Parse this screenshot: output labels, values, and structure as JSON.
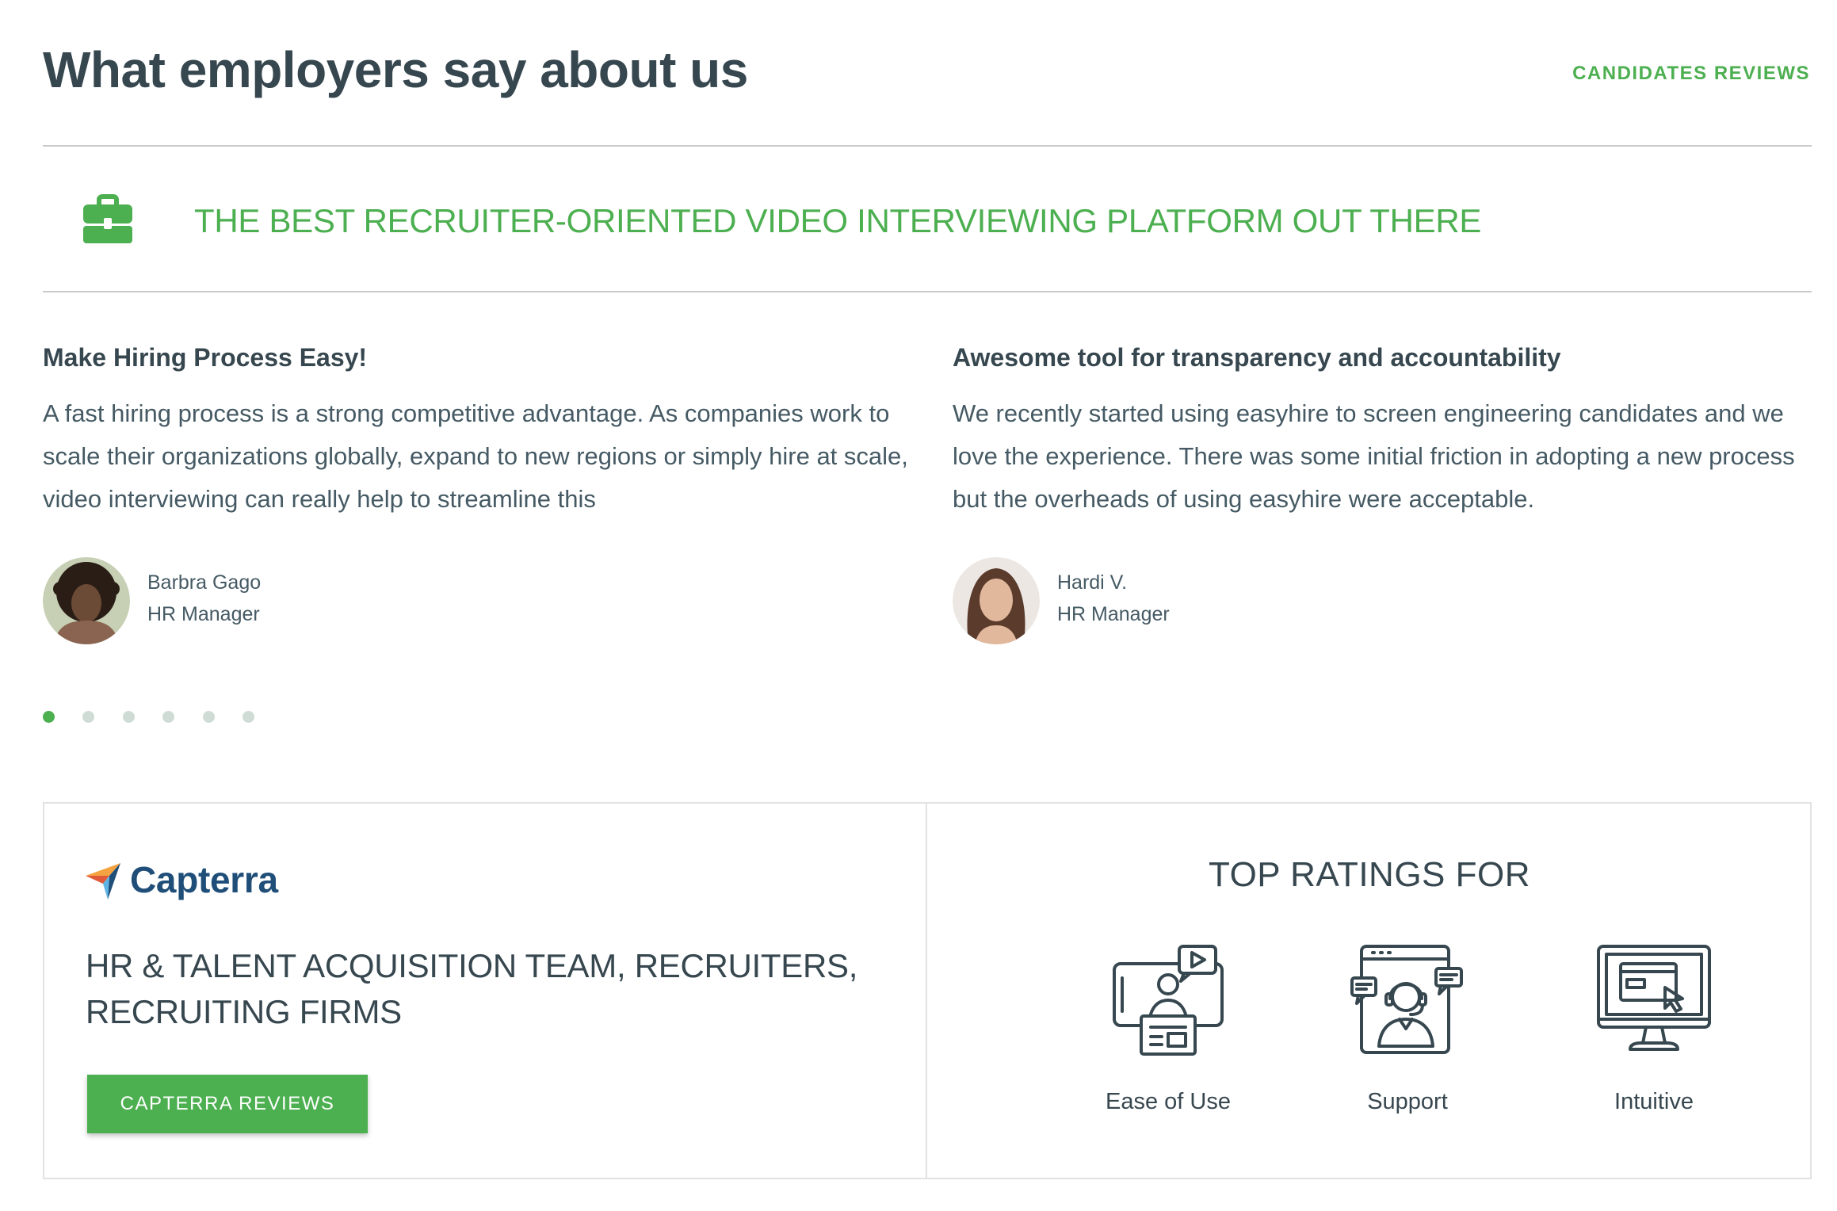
{
  "header": {
    "title": "What employers say about us",
    "candidates_link": "CANDIDATES REVIEWS"
  },
  "banner": {
    "icon": "briefcase-icon",
    "text": "THE BEST RECRUITER-ORIENTED VIDEO INTERVIEWING PLATFORM OUT THERE"
  },
  "reviews": [
    {
      "title": "Make Hiring Process Easy!",
      "body": "A fast hiring process is a strong competitive advantage. As companies work to scale their organizations globally, expand to new regions or simply hire at scale, video interviewing can really help to streamline this",
      "author": "Barbra Gago",
      "role": "HR Manager"
    },
    {
      "title": "Awesome tool for transparency and accountability",
      "body": "We recently started using easyhire to screen engineering candidates and we love the experience. There was some initial friction in adopting a new process but the overheads of using easyhire were acceptable.",
      "author": "Hardi V.",
      "role": "HR Manager"
    }
  ],
  "carousel": {
    "dot_count": 6,
    "active_index": 0
  },
  "capterra": {
    "logo_text": "Capterra",
    "audience": "HR & TALENT ACQUISITION TEAM, RECRUITERS, RECRUITING FIRMS",
    "button_label": "CAPTERRA REVIEWS"
  },
  "top_ratings": {
    "title": "TOP RATINGS FOR",
    "items": [
      {
        "label": "Ease of Use",
        "icon": "video-interview-icon"
      },
      {
        "label": "Support",
        "icon": "support-agent-icon"
      },
      {
        "label": "Intuitive",
        "icon": "monitor-cursor-icon"
      }
    ]
  },
  "colors": {
    "accent": "#4caf50",
    "heading": "#37474f",
    "body_text": "#455a64",
    "capterra_blue": "#1f4e79",
    "inactive_dot": "#cfdcd6",
    "divider": "#c9c9c9"
  }
}
